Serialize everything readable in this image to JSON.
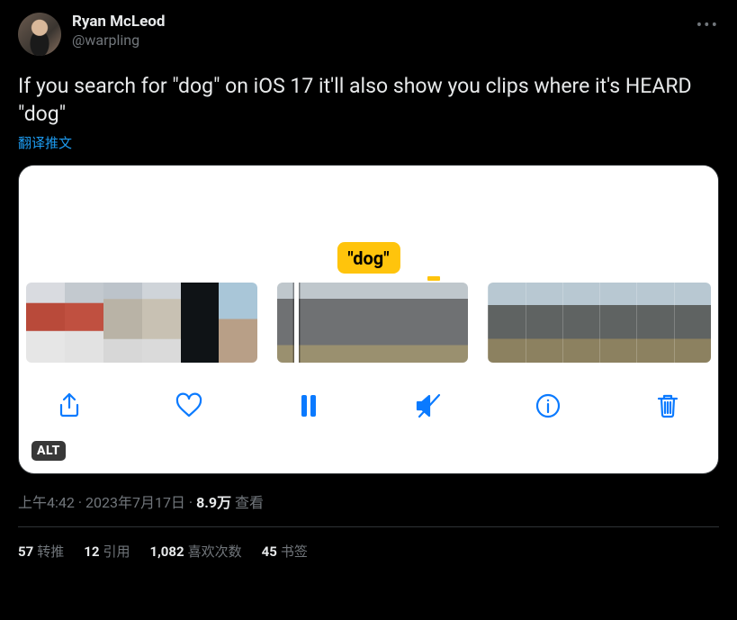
{
  "author": {
    "display_name": "Ryan McLeod",
    "handle": "@warpling"
  },
  "tweet_text": "If you search for \"dog\" on iOS 17 it'll also show you clips where it's HEARD \"dog\"",
  "translate_label": "翻译推文",
  "media": {
    "search_token": "\"dog\"",
    "alt_badge": "ALT",
    "toolbar": {
      "share": "share",
      "like": "like",
      "pause": "pause",
      "mute": "mute",
      "info": "info",
      "delete": "delete"
    }
  },
  "meta": {
    "time": "上午4:42",
    "sep": " · ",
    "date": "2023年7月17日",
    "views_number": "8.9万",
    "views_label": " 查看"
  },
  "stats": {
    "retweets": {
      "num": "57",
      "label": "转推"
    },
    "quotes": {
      "num": "12",
      "label": "引用"
    },
    "likes": {
      "num": "1,082",
      "label": "喜欢次数"
    },
    "bookmarks": {
      "num": "45",
      "label": "书签"
    }
  }
}
